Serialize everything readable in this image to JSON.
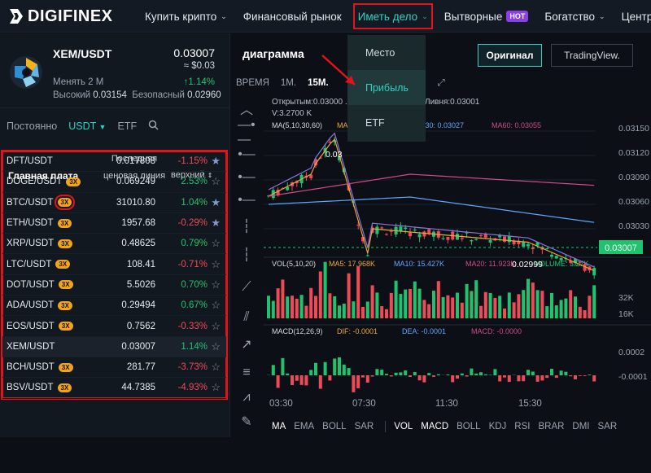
{
  "brand": {
    "name": "DIGIFINEX"
  },
  "nav": {
    "items": [
      {
        "label": "Купить крипто",
        "caret": true
      },
      {
        "label": "Финансовый рынок",
        "caret": false
      },
      {
        "label": "Иметь дело",
        "caret": true,
        "active": true
      },
      {
        "label": "Вытворные",
        "badge": "HOT",
        "caret": false
      },
      {
        "label": "Богатство",
        "caret": true
      },
      {
        "label": "Центр по",
        "caret": false
      }
    ]
  },
  "pair": {
    "name": "XEM/USDT",
    "price": "0.03007",
    "usd": "≈ $0.03",
    "change_label": "Менять 2 М",
    "change_value": "↑1.14%",
    "high_label": "Высокий",
    "high": "0.03154",
    "low_label": "Безопасный",
    "low": "0.02960"
  },
  "market_tabs": {
    "items": [
      "Постоянно",
      "USDT",
      "ETF"
    ],
    "active": "USDT"
  },
  "columns": {
    "name": "Главная плата",
    "price": "Последняя ценовая линия",
    "change": "верхний"
  },
  "rows": [
    {
      "name": "DFT/USDT",
      "badge": "",
      "price": "0.017808",
      "change": "-1.15%",
      "dir": "neg",
      "star": true
    },
    {
      "name": "DOGE/USDT",
      "badge": "3X",
      "price": "0.069249",
      "change": "2.53%",
      "dir": "pos",
      "star": false
    },
    {
      "name": "BTC/USDT",
      "badge": "3X",
      "price": "31010.80",
      "change": "1.04%",
      "dir": "pos",
      "star": true,
      "boxed": true
    },
    {
      "name": "ETH/USDT",
      "badge": "3X",
      "price": "1957.68",
      "change": "-0.29%",
      "dir": "neg",
      "star": true
    },
    {
      "name": "XRP/USDT",
      "badge": "3X",
      "price": "0.48625",
      "change": "0.79%",
      "dir": "pos",
      "star": false
    },
    {
      "name": "LTC/USDT",
      "badge": "3X",
      "price": "108.41",
      "change": "-0.71%",
      "dir": "neg",
      "star": false
    },
    {
      "name": "DOT/USDT",
      "badge": "3X",
      "price": "5.5026",
      "change": "0.70%",
      "dir": "pos",
      "star": false
    },
    {
      "name": "ADA/USDT",
      "badge": "3X",
      "price": "0.29494",
      "change": "0.67%",
      "dir": "pos",
      "star": false
    },
    {
      "name": "EOS/USDT",
      "badge": "3X",
      "price": "0.7562",
      "change": "-0.33%",
      "dir": "neg",
      "star": false
    },
    {
      "name": "XEM/USDT",
      "badge": "",
      "price": "0.03007",
      "change": "1.14%",
      "dir": "pos",
      "star": false,
      "highlight": true
    },
    {
      "name": "BCH/USDT",
      "badge": "3X",
      "price": "281.77",
      "change": "-3.73%",
      "dir": "neg",
      "star": false
    },
    {
      "name": "BSV/USDT",
      "badge": "3X",
      "price": "44.7385",
      "change": "-4.93%",
      "dir": "neg",
      "star": false
    }
  ],
  "chart": {
    "title": "диаграмма",
    "btn_original": "Оригинал",
    "btn_tv": "TradingView.",
    "timeframes": [
      "ВРЕМЯ",
      "1М.",
      "15М."
    ],
    "active_tf": "15М.",
    "ohlc_line": "Открытым:0.03000 ... 3007 ЧАС:0.03007 Ливня:0.03001",
    "vol_line": "V:3.2700 K",
    "ma_legend": [
      {
        "label": "MA(5,10,30,60)",
        "color": "#d5dae2"
      },
      {
        "label": "MA5: 0.03014",
        "color": "#e9a83a"
      },
      {
        "label": "MA30: 0.03027",
        "color": "#5fa8ff"
      },
      {
        "label": "MA60: 0.03055",
        "color": "#d04a8a"
      }
    ],
    "last_price": "0.03007",
    "low_mark": "0.02999",
    "high_mark": "0.03",
    "y_ticks": [
      "0.03150",
      "0.03120",
      "0.03090",
      "0.03060",
      "0.03030"
    ],
    "vol_legend": [
      {
        "label": "VOL(5,10,20)",
        "color": "#d5dae2"
      },
      {
        "label": "MA5: 17.968K",
        "color": "#e9a83a"
      },
      {
        "label": "MA10: 15.427K",
        "color": "#5fa8ff"
      },
      {
        "label": "MA20: 11.923K",
        "color": "#d04a8a"
      },
      {
        "label": "VOLUME: 3.27K",
        "color": "#1fc36f"
      }
    ],
    "vol_ticks": [
      "32K",
      "16K"
    ],
    "macd_legend": [
      {
        "label": "MACD(12,26,9)",
        "color": "#d5dae2"
      },
      {
        "label": "DIF: -0.0001",
        "color": "#e9a83a"
      },
      {
        "label": "DEA: -0.0001",
        "color": "#5fa8ff"
      },
      {
        "label": "MACD: -0.0000",
        "color": "#d04a8a"
      }
    ],
    "macd_ticks": [
      "0.0002",
      "-0.0001"
    ],
    "x_ticks": [
      "03:30",
      "07:30",
      "11:30",
      "15:30"
    ],
    "indicators_main": [
      "MA",
      "EMA",
      "BOLL",
      "SAR"
    ],
    "indicators_sub": [
      "VOL",
      "MACD",
      "BOLL",
      "KDJ",
      "RSI",
      "BRAR",
      "DMI",
      "SAR"
    ],
    "active_main": "MA",
    "active_sub": [
      "VOL",
      "MACD"
    ]
  },
  "dropdown": {
    "items": [
      "Место",
      "Прибыль",
      "ETF"
    ],
    "selected": "Прибыль"
  },
  "colors": {
    "accent": "#2fd0c4",
    "up": "#1fc36f",
    "down": "#ef4a57",
    "highlight_box": "#e3131b"
  }
}
